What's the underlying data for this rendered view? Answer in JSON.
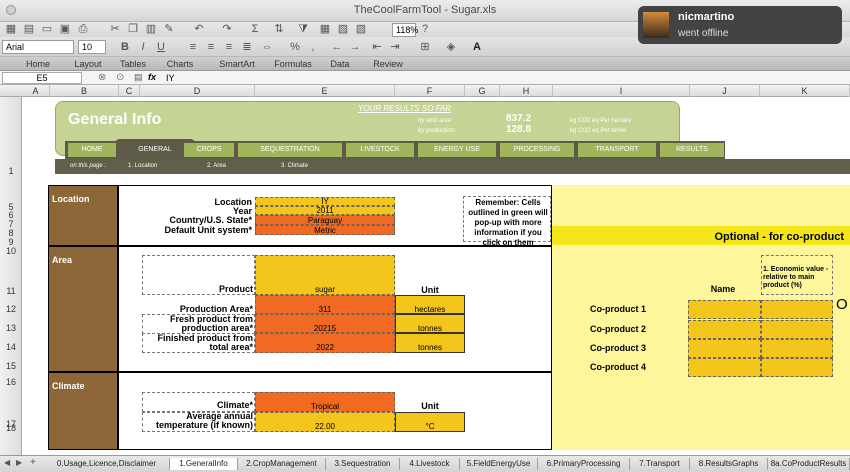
{
  "window": {
    "title": "TheCoolFarmTool - Sugar.xls"
  },
  "toolbar": {
    "zoom": "118%",
    "font_name": "Arial",
    "font_size": "10"
  },
  "ribbon": {
    "tabs": [
      "Home",
      "Layout",
      "Tables",
      "Charts",
      "SmartArt",
      "Formulas",
      "Data",
      "Review"
    ]
  },
  "formula_bar": {
    "cell_ref": "E5",
    "fx": "fx",
    "value": "IY"
  },
  "columns": [
    "A",
    "B",
    "C",
    "D",
    "E",
    "F",
    "G",
    "H",
    "I",
    "J",
    "K"
  ],
  "rows": [
    "1",
    "5",
    "6",
    "7",
    "8",
    "9",
    "10",
    "11",
    "12",
    "13",
    "14",
    "15",
    "16",
    "17",
    "18"
  ],
  "banner": {
    "title": "General Info",
    "results_title": "YOUR RESULTS SO FAR",
    "by_land_area": "by land area:",
    "by_production": "by production:",
    "land_value": "837.2",
    "prod_value": "128.8",
    "land_unit": "kg CO2 eq   Per hectare",
    "prod_unit": "kg CO2 eq   Per tonne"
  },
  "nav": [
    "HOME",
    "GENERAL",
    "CROPS",
    "SEQUESTRATION",
    "LIVESTOCK",
    "ENERGY USE",
    "PROCESSING",
    "TRANSPORT",
    "RESULTS"
  ],
  "subnav": {
    "label": "on this page :",
    "items": [
      "1. Location",
      "2. Area",
      "3. Climate"
    ]
  },
  "location": {
    "section": "Location",
    "labels": [
      "Location",
      "Year",
      "Country/U.S. State*",
      "Default Unit system*"
    ],
    "values": [
      "IY",
      "2011",
      "Paraguay",
      "Metric"
    ],
    "remember": "Remember: Cells outlined in green will pop-up with more information if you click on them"
  },
  "area": {
    "section": "Area",
    "product_label": "Product",
    "product_value": "sugar",
    "unit_header": "Unit",
    "rows": [
      {
        "label": "Production Area*",
        "value": "311",
        "unit": "hectares"
      },
      {
        "label": "Fresh product from production area*",
        "value": "20215",
        "unit": "tonnes"
      },
      {
        "label": "Finished product from total area*",
        "value": "2022",
        "unit": "tonnes"
      }
    ]
  },
  "climate": {
    "section": "Climate",
    "climate_label": "Climate*",
    "climate_value": "Tropical",
    "unit_header": "Unit",
    "temp_label": "Average annual temperature (if known)",
    "temp_value": "22.00",
    "temp_unit": "°C"
  },
  "coproduct": {
    "title": "Optional - for co-product",
    "name_header": "Name",
    "econ_header": "1. Economic value - relative to main product (%)",
    "items": [
      "Co-product 1",
      "Co-product 2",
      "Co-product 3",
      "Co-product 4"
    ],
    "edge_glyph": "O"
  },
  "sheet_tabs": [
    "0.Usage,Licence,Disclaimer",
    "1.GeneralInfo",
    "2.CropManagement",
    "3.Sequestration",
    "4.Livestock",
    "5.FieldEnergyUse",
    "6.PrimaryProcessing",
    "7.Transport",
    "8.ResultsGraphs",
    "8a.CoProductResults"
  ],
  "notification": {
    "user": "nicmartino",
    "message": "went offline"
  },
  "colors": {
    "banner": "#c5d494",
    "nav": "#a1b55d",
    "section": "#8c6637",
    "yellow": "#f4c51b",
    "orange": "#f26a21",
    "optional": "#fef69a"
  }
}
